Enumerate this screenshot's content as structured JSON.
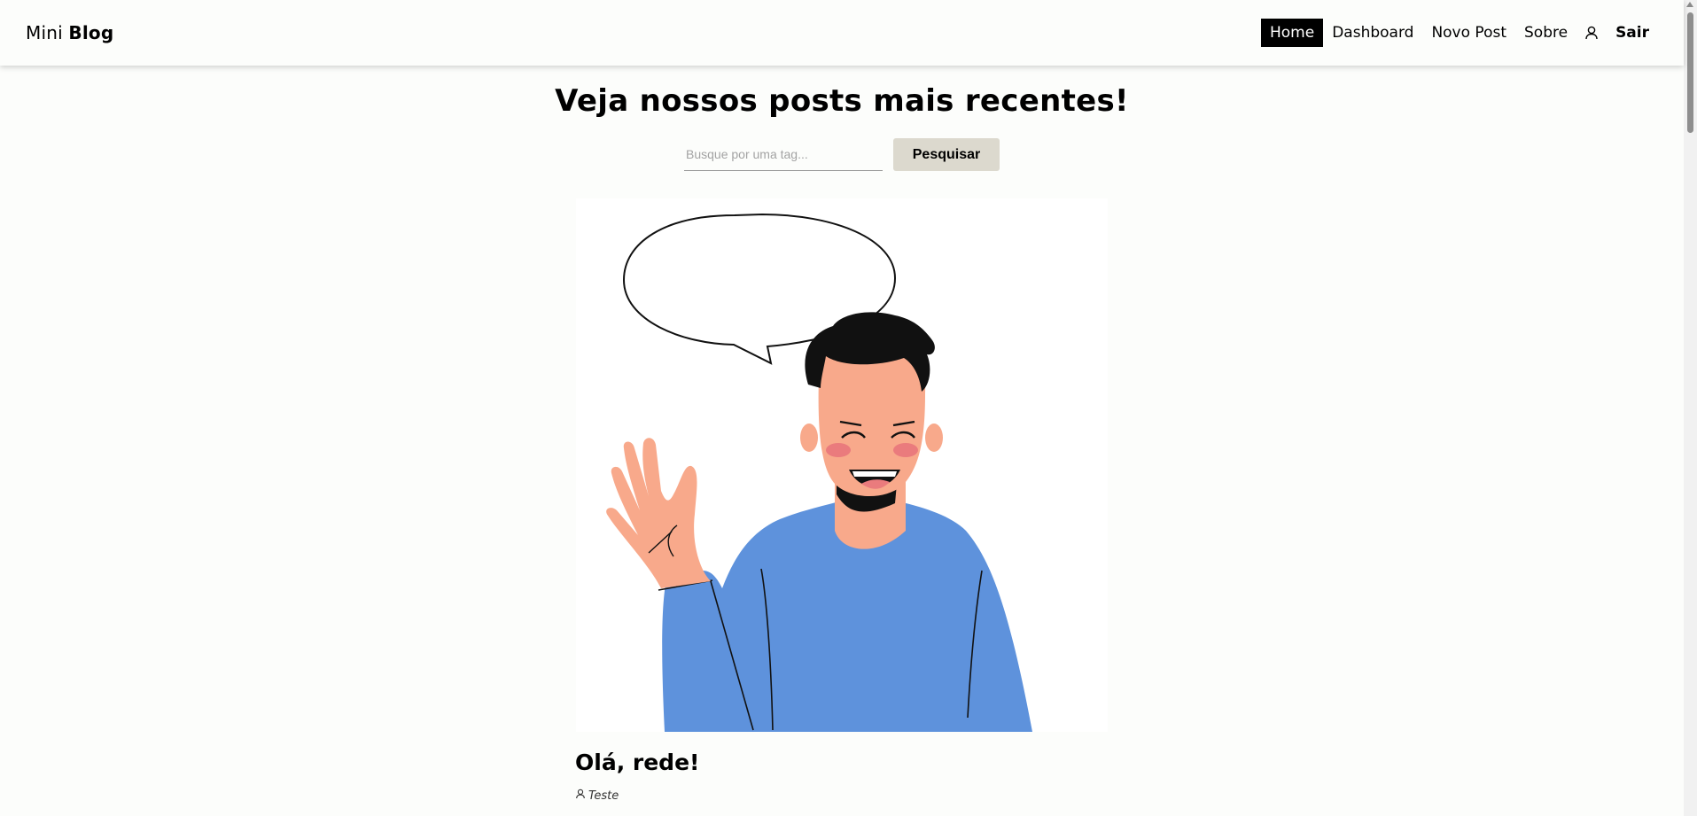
{
  "brand": {
    "part1": "Mini",
    "part2": "Blog"
  },
  "nav": {
    "items": [
      {
        "label": "Home",
        "active": true
      },
      {
        "label": "Dashboard",
        "active": false
      },
      {
        "label": "Novo Post",
        "active": false
      },
      {
        "label": "Sobre",
        "active": false
      }
    ],
    "profile_icon": "user-icon",
    "logout_label": "Sair"
  },
  "main": {
    "title": "Veja nossos posts mais recentes!",
    "search": {
      "placeholder": "Busque por uma tag...",
      "value": "",
      "button_label": "Pesquisar"
    }
  },
  "post": {
    "image_icon": "waving-person-illustration",
    "title": "Olá, rede!",
    "author_icon": "user-icon",
    "author": "Teste"
  },
  "colors": {
    "background": "#fcfdfb",
    "active_nav_bg": "#000000",
    "search_button_bg": "#dcd9ce",
    "shirt": "#5e92dc",
    "skin": "#f8a98b"
  }
}
